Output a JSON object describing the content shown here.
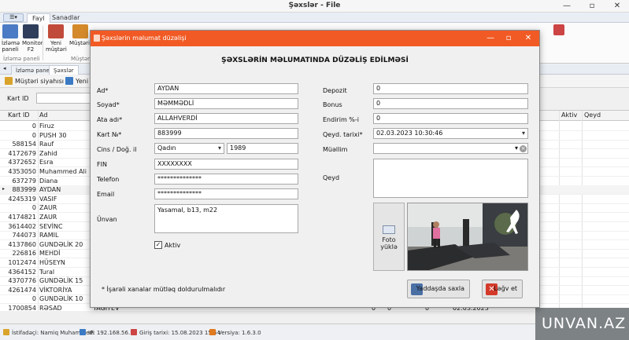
{
  "window": {
    "title": "Şəxslər - File",
    "minimize": "—",
    "maximize": "▫",
    "close": "✕"
  },
  "top_tabs": [
    "Fayl",
    "Sanadlar"
  ],
  "ribbon": {
    "buttons": [
      {
        "label": "İzləmə\npaneli",
        "color": "#4a7bc4"
      },
      {
        "label": "Monitor\nF2",
        "color": "#2f3e5a"
      },
      {
        "label": "Yeni\nmüştəri",
        "color": "#c14b3a"
      },
      {
        "label": "Müştərilər",
        "color": "#d48a2b"
      }
    ],
    "group_labels": [
      "İzləmə paneli",
      "Müştəri"
    ],
    "extra_icon_colors": [
      "#3c8e3c",
      "#e07a20",
      "#5a8fd0",
      "#c44",
      "#3f9b4f",
      "#4a7bc4",
      "#7f5ac9",
      "#9a9a9a",
      "#c44"
    ]
  },
  "doc_tabs": [
    "İzləmə paneli",
    "Şəxslər"
  ],
  "toolbar2": [
    {
      "label": "Müştəri siyahısı",
      "color": "#d9a32b"
    },
    {
      "label": "Yeni",
      "color": "#3a7ac4"
    }
  ],
  "filter": {
    "label": "Kart ID",
    "value": ""
  },
  "grid": {
    "headers": {
      "id": "Kart ID",
      "name": "Ad",
      "aktiv": "Aktiv",
      "qeyd": "Qeyd"
    },
    "rows": [
      {
        "id": "0",
        "name": "Firuz"
      },
      {
        "id": "0",
        "name": "PUSH 30"
      },
      {
        "id": "588154",
        "name": "Rauf"
      },
      {
        "id": "4172679",
        "name": "Zahid"
      },
      {
        "id": "4372652",
        "name": "Esra"
      },
      {
        "id": "4353050",
        "name": "Muhammed Ali"
      },
      {
        "id": "637279",
        "name": "Diana"
      },
      {
        "id": "883999",
        "name": "AYDAN",
        "selected": true
      },
      {
        "id": "4245319",
        "name": "VASIF"
      },
      {
        "id": "0",
        "name": "ZAUR"
      },
      {
        "id": "4174821",
        "name": "ZAUR"
      },
      {
        "id": "3614402",
        "name": "SEVİNC"
      },
      {
        "id": "744073",
        "name": "RAMIL"
      },
      {
        "id": "4137860",
        "name": "GUNDƏLİK 20"
      },
      {
        "id": "226816",
        "name": "MEHDİ"
      },
      {
        "id": "1012474",
        "name": "HÜSEYN"
      },
      {
        "id": "4364152",
        "name": "Tural"
      },
      {
        "id": "4370776",
        "name": "GUNDƏLİK 15"
      },
      {
        "id": "4261474",
        "name": "VİKTORİYA"
      },
      {
        "id": "0",
        "name": "GUNDƏLİK 10"
      },
      {
        "id": "1700854",
        "name": "RƏSAD",
        "extra1": "TAĞIYEV",
        "extra2": "0",
        "extra3": "0",
        "extra4": "0",
        "extra5": "02.03.2023"
      }
    ]
  },
  "statusbar": {
    "user": "İstifadəçi: Namiq Muhammedi",
    "ip": "IP: 192.168.56.1",
    "login": "Giriş tarixi: 15.08.2023 15:54",
    "version": "Versiya: 1.6.3.0"
  },
  "watermark": "UNVAN.AZ",
  "dialog": {
    "title": "Şəxslərin məlumat düzəlişi",
    "heading": "ŞƏXSLƏRİN MƏLUMATINDA DÜZƏLİŞ EDİLMƏSİ",
    "labels": {
      "ad": "Ad*",
      "soyad": "Soyad*",
      "ata_adi": "Ata adı*",
      "kart_no": "Kart №*",
      "cins_dogum": "Cins / Doğ. il",
      "fin": "FIN",
      "telefon": "Telefon",
      "email": "Email",
      "unvan": "Ünvan",
      "depozit": "Depozit",
      "bonus": "Bonus",
      "endirim": "Endirim %-i",
      "qeyd_tarixi": "Qeyd. tarixi*",
      "muellim": "Müəllim",
      "qeyd": "Qeyd",
      "aktiv": "Aktiv"
    },
    "values": {
      "ad": "AYDAN",
      "soyad": "MƏMMƏDLİ",
      "ata_adi": "ALLAHVERDİ",
      "kart_no": "883999",
      "cins": "Qadın",
      "dogum_ili": "1989",
      "fin": "XXXXXXXX",
      "telefon": "**************",
      "email": "**************",
      "unvan": "Yasamal, b13, m22",
      "depozit": "0",
      "bonus": "0",
      "endirim": "0",
      "qeyd_tarixi": "02.03.2023 10:30:46",
      "muellim": "",
      "qeyd": "",
      "aktiv_checked": true
    },
    "photo_button": "Foto\nyüklə",
    "note": "* İşarəli xanalar mütləq doldurulmalıdır",
    "save_button": "Yaddaşda saxla",
    "cancel_button": "Ləğv et",
    "save_icon_color": "#4a6fa5",
    "cancel_icon_color": "#d43a2a"
  }
}
